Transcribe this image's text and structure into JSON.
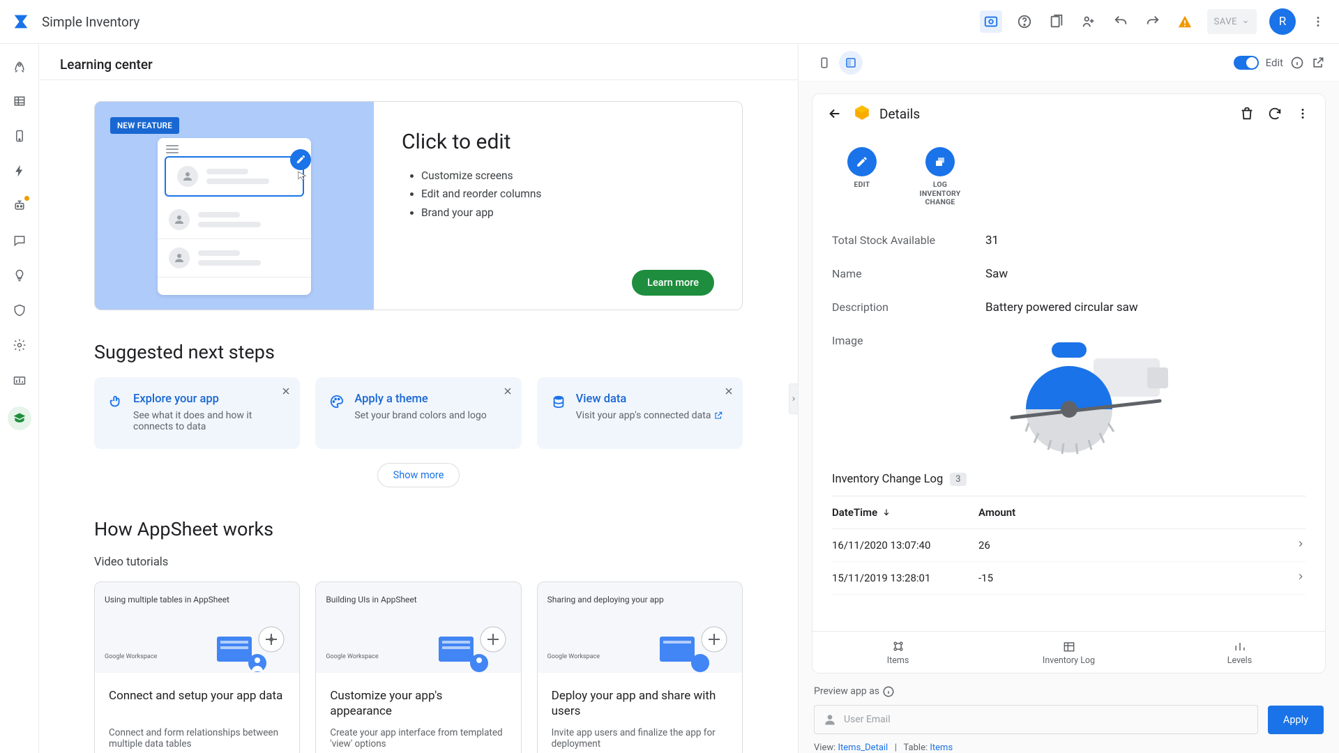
{
  "header": {
    "app_title": "Simple Inventory",
    "save_label": "SAVE",
    "avatar_letter": "R"
  },
  "center": {
    "title": "Learning center",
    "feature": {
      "badge": "NEW FEATURE",
      "heading": "Click to edit",
      "bullets": [
        "Customize screens",
        "Edit and reorder columns",
        "Brand your app"
      ],
      "cta": "Learn more"
    },
    "suggested_title": "Suggested next steps",
    "suggestions": [
      {
        "title": "Explore your app",
        "desc": "See what it does and how it connects to data"
      },
      {
        "title": "Apply a theme",
        "desc": "Set your brand colors and logo"
      },
      {
        "title": "View data",
        "desc": "Visit your app's connected data"
      }
    ],
    "show_more": "Show more",
    "how_title": "How AppSheet works",
    "tutorials_label": "Video tutorials",
    "tutorials": [
      {
        "thumb_title": "Using multiple tables in AppSheet",
        "ws": "Google Workspace",
        "title": "Connect and setup your app data",
        "desc": "Connect and form relationships between multiple data tables"
      },
      {
        "thumb_title": "Building UIs in AppSheet",
        "ws": "Google Workspace",
        "title": "Customize your app's appearance",
        "desc": "Create your app interface from templated 'view' options"
      },
      {
        "thumb_title": "Sharing and deploying your app",
        "ws": "Google Workspace",
        "title": "Deploy your app and share with users",
        "desc": "Invite app users and finalize the app for deployment"
      }
    ]
  },
  "preview": {
    "edit_label": "Edit",
    "details_title": "Details",
    "actions": {
      "edit": "EDIT",
      "log": "LOG INVENTORY CHANGE"
    },
    "fields": {
      "stock_label": "Total Stock Available",
      "stock_value": "31",
      "name_label": "Name",
      "name_value": "Saw",
      "desc_label": "Description",
      "desc_value": "Battery powered circular saw",
      "image_label": "Image"
    },
    "log_title": "Inventory Change Log",
    "log_count": "3",
    "log_columns": {
      "dt": "DateTime",
      "amt": "Amount"
    },
    "log_rows": [
      {
        "dt": "16/11/2020 13:07:40",
        "amt": "26"
      },
      {
        "dt": "15/11/2019 13:28:01",
        "amt": "-15"
      }
    ],
    "nav": {
      "items": "Items",
      "invlog": "Inventory Log",
      "levels": "Levels"
    },
    "preview_as": "Preview app as",
    "email_placeholder": "User Email",
    "apply": "Apply",
    "links": {
      "view_lbl": "View:",
      "view_val": "Items_Detail",
      "table_lbl": "Table:",
      "table_val": "Items"
    }
  }
}
